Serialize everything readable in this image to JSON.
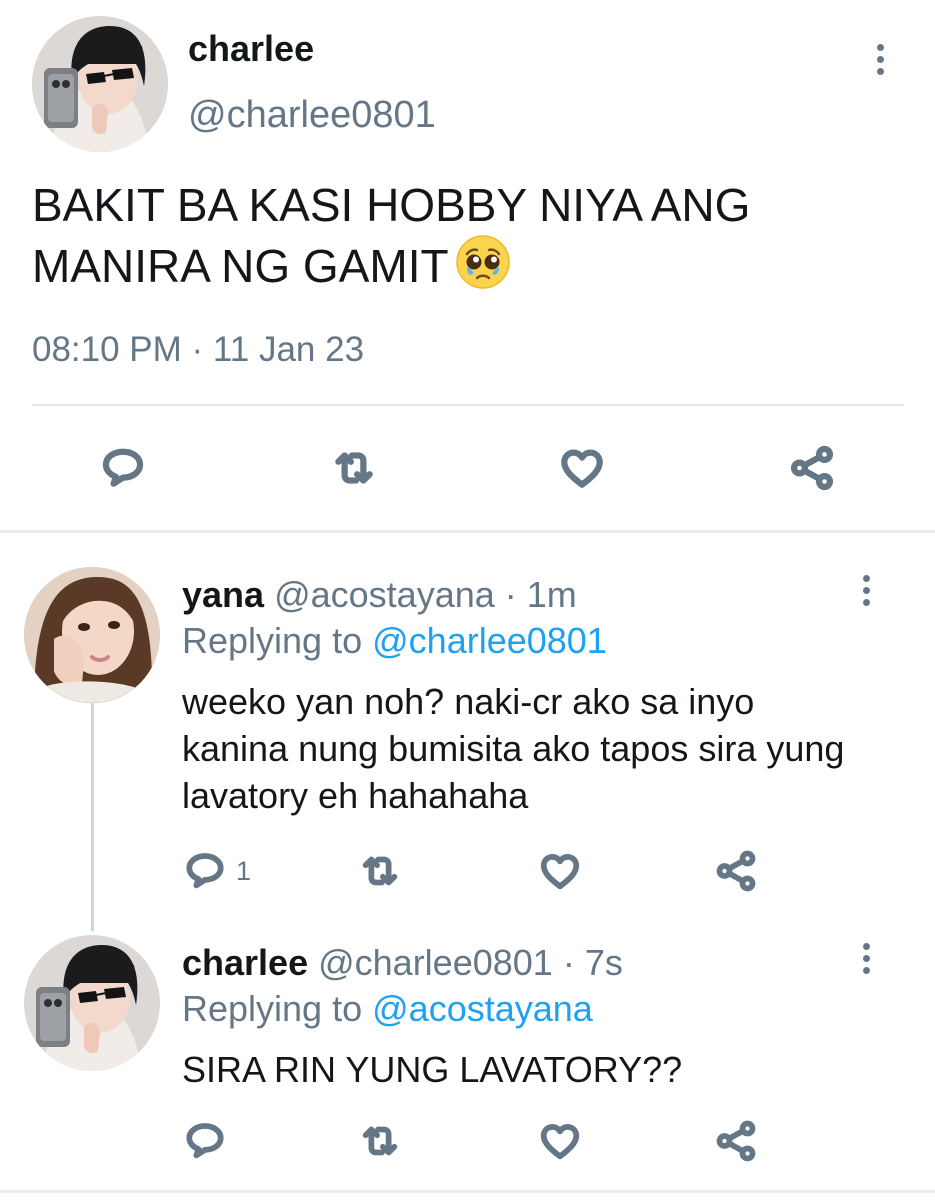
{
  "main_tweet": {
    "name": "charlee",
    "handle": "@charlee0801",
    "text": "BAKIT BA KASI HOBBY NIYA ANG MANIRA NG GAMIT",
    "emoji": "pleading-face-with-tears",
    "timestamp": "08:10 PM · 11 Jan 23",
    "actions": [
      "reply-icon",
      "retweet-icon",
      "like-icon",
      "share-icon"
    ]
  },
  "replies": [
    {
      "name": "yana",
      "handle": "@acostayana",
      "time": "· 1m",
      "replying_label": "Replying to",
      "replying_to": "@charlee0801",
      "text": "weeko yan noh? naki-cr ako sa inyo kanina nung bumisita ako tapos sira yung lavatory eh hahahaha",
      "reply_count": "1"
    },
    {
      "name": "charlee",
      "handle": "@charlee0801",
      "time": "· 7s",
      "replying_label": "Replying to",
      "replying_to": "@acostayana",
      "text": "SIRA RIN YUNG LAVATORY??",
      "reply_count": ""
    }
  ],
  "colors": {
    "text": "#14171a",
    "secondary": "#657786",
    "link": "#1da1f2",
    "divider": "#e1e8ed"
  }
}
